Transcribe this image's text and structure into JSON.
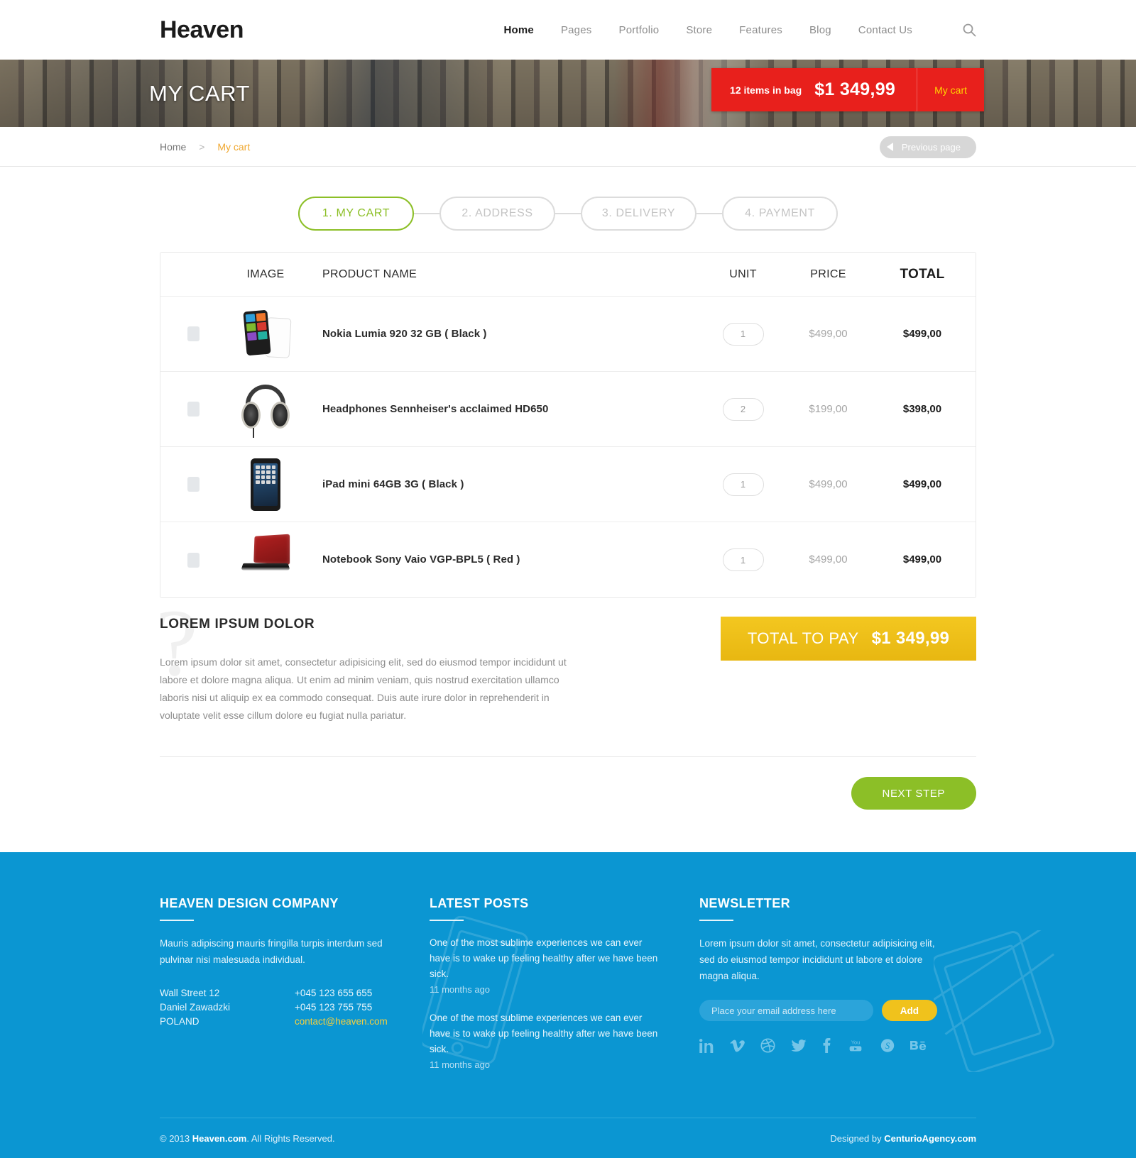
{
  "header": {
    "logo": "Heaven",
    "nav": [
      {
        "label": "Home",
        "active": true
      },
      {
        "label": "Pages",
        "active": false
      },
      {
        "label": "Portfolio",
        "active": false
      },
      {
        "label": "Store",
        "active": false
      },
      {
        "label": "Features",
        "active": false
      },
      {
        "label": "Blog",
        "active": false
      },
      {
        "label": "Contact Us",
        "active": false
      }
    ],
    "search_icon": "search-icon"
  },
  "hero": {
    "title": "MY CART",
    "cart_items": "12 items in bag",
    "cart_amount": "$1 349,99",
    "cart_link": "My cart",
    "accent_red": "#e8201c",
    "accent_yellow": "#ffd400"
  },
  "breadcrumb": {
    "home": "Home",
    "separator": ">",
    "current": "My cart",
    "previous_page": "Previous page"
  },
  "steps": [
    {
      "label": "1.  MY CART",
      "active": true
    },
    {
      "label": "2.  ADDRESS",
      "active": false
    },
    {
      "label": "3.  DELIVERY",
      "active": false
    },
    {
      "label": "4.  PAYMENT",
      "active": false
    }
  ],
  "cart": {
    "columns": {
      "image": "IMAGE",
      "product_name": "PRODUCT NAME",
      "unit": "UNIT",
      "price": "PRICE",
      "total": "TOTAL"
    },
    "rows": [
      {
        "name": "Nokia Lumia 920 32 GB  ( Black )",
        "unit": "1",
        "price": "$499,00",
        "total": "$499,00",
        "thumb": "nokia-lumia-thumb"
      },
      {
        "name": "Headphones Sennheiser's acclaimed HD650",
        "unit": "2",
        "price": "$199,00",
        "total": "$398,00",
        "thumb": "headphones-thumb"
      },
      {
        "name": "iPad mini 64GB 3G ( Black )",
        "unit": "1",
        "price": "$499,00",
        "total": "$499,00",
        "thumb": "ipad-mini-thumb"
      },
      {
        "name": "Notebook Sony Vaio VGP-BPL5 ( Red )",
        "unit": "1",
        "price": "$499,00",
        "total": "$499,00",
        "thumb": "sony-vaio-thumb"
      }
    ]
  },
  "summary": {
    "heading": "LOREM IPSUM DOLOR",
    "body": "Lorem ipsum dolor sit amet, consectetur adipisicing elit, sed do eiusmod tempor incididunt ut labore et dolore magna aliqua. Ut enim ad minim veniam, quis nostrud exercitation ullamco laboris nisi ut aliquip ex ea commodo consequat. Duis aute irure dolor in reprehenderit in voluptate velit esse cillum dolore eu fugiat nulla pariatur.",
    "watermark": "?",
    "total_label": "TOTAL TO PAY",
    "total_value": "$1 349,99",
    "next_step": "NEXT STEP",
    "accent_green": "#8cbf27",
    "accent_gold": "#e8b711"
  },
  "footer": {
    "company": {
      "heading": "HEAVEN DESIGN COMPANY",
      "text": "Mauris adipiscing mauris fringilla turpis interdum sed pulvinar nisi malesuada individual.",
      "address_lines": [
        "Wall Street 12",
        "Daniel Zawadzki",
        "POLAND"
      ],
      "contact_lines": [
        "+045 123 655 655",
        "+045 123 755 755"
      ],
      "email": "contact@heaven.com"
    },
    "posts": {
      "heading": "LATEST POSTS",
      "items": [
        {
          "text": "One of the most sublime experiences we can ever have is to wake up feeling healthy after we have been sick.",
          "ago": "11 months ago"
        },
        {
          "text": "One of the most sublime experiences we can ever have is to wake up feeling healthy after we have been sick.",
          "ago": "11 months ago"
        }
      ]
    },
    "newsletter": {
      "heading": "NEWSLETTER",
      "text": "Lorem ipsum dolor sit amet, consectetur adipisicing elit, sed do eiusmod tempor incididunt ut labore et dolore magna aliqua.",
      "placeholder": "Place your email address here",
      "value": "",
      "add_label": "Add",
      "socials": [
        "linkedin-icon",
        "vimeo-icon",
        "dribbble-icon",
        "twitter-icon",
        "facebook-icon",
        "youtube-icon",
        "skype-icon",
        "behance-icon"
      ]
    },
    "copyright_prefix": "© 2013 ",
    "copyright_brand": "Heaven.com",
    "copyright_suffix": ". All Rights Reserved.",
    "designed_prefix": "Designed by ",
    "designed_brand": "CenturioAgency.com",
    "bg": "#0b96d2"
  }
}
